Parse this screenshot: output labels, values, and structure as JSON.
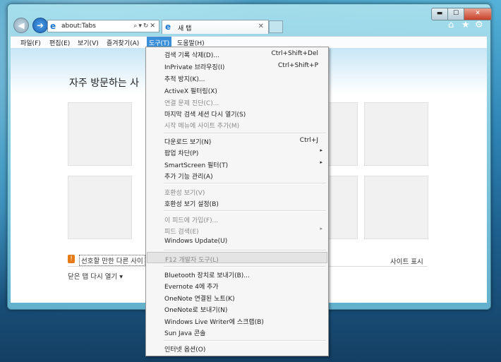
{
  "window": {
    "address": "about:Tabs",
    "tab_title": "새 탭",
    "caption": {
      "minimize": "▬",
      "maximize": "☐",
      "close": "✕"
    }
  },
  "menubar": {
    "items": [
      "파일(F)",
      "편집(E)",
      "보기(V)",
      "즐겨찾기(A)",
      "도구(T)",
      "도움말(H)"
    ],
    "active": "도구(T)"
  },
  "page": {
    "heading": "자주 방문하는 사",
    "tip": "선호할 만한 다른 사이",
    "show_sites": "사이트 표시",
    "reopen": "닫은 탭 다시 열기 ▾"
  },
  "icons": {
    "back": "back-arrow-icon",
    "forward": "forward-arrow-icon",
    "home": "home-icon",
    "favorites": "star-icon",
    "tools": "gear-icon",
    "ie": "ie-logo-icon"
  },
  "colors": {
    "menu_active": "#3a8fd8",
    "close_button": "#c8402a",
    "window_frame": "#7cc3dc",
    "disabled_text": "#8a8a8a"
  },
  "tools_menu": {
    "items": [
      {
        "label": "검색 기록 삭제(D)...",
        "shortcut": "Ctrl+Shift+Del"
      },
      {
        "label": "InPrivate 브라우징(I)",
        "shortcut": "Ctrl+Shift+P"
      },
      {
        "label": "추적 방지(K)..."
      },
      {
        "label": "ActiveX 필터링(X)"
      },
      {
        "label": "연결 문제 진단(C)...",
        "disabled": true
      },
      {
        "label": "마지막 검색 세션 다시 열기(S)"
      },
      {
        "label": "시작 메뉴에 사이트 추가(M)",
        "disabled": true
      },
      {
        "label": "다운로드 보기(N)",
        "shortcut": "Ctrl+J"
      },
      {
        "label": "팝업 차단(P)",
        "submenu": "▸"
      },
      {
        "label": "SmartScreen 필터(T)",
        "submenu": "▸"
      },
      {
        "label": "추가 기능 관리(A)"
      },
      {
        "label": "호환성 보기(V)",
        "disabled": true
      },
      {
        "label": "호환성 보기 설정(B)"
      },
      {
        "label": "이 피드에 가입(F)...",
        "disabled": true
      },
      {
        "label": "피드 검색(E)",
        "disabled": true,
        "submenu": "▸"
      },
      {
        "label": "Windows Update(U)"
      },
      {
        "label": "F12 개발자 도구(L)",
        "disabled": true,
        "highlighted": true
      },
      {
        "label": "Bluetooth 장치로 보내기(B)..."
      },
      {
        "label": "Evernote 4에 추가"
      },
      {
        "label": "OneNote 연결된 노트(K)"
      },
      {
        "label": "OneNote로 보내기(N)"
      },
      {
        "label": "Windows Live Writer에 스크랩(B)"
      },
      {
        "label": "Sun Java 콘솔"
      },
      {
        "label": "인터넷 옵션(O)"
      }
    ]
  }
}
